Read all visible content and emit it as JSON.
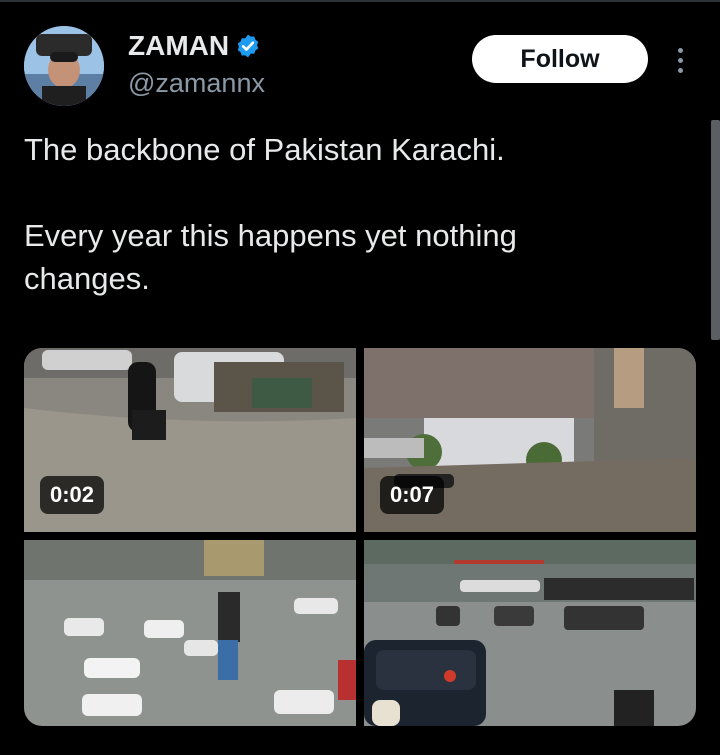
{
  "author": {
    "display_name": "ZAMAN",
    "handle": "@zamannx",
    "verified": true,
    "verified_color": "#1d9bf0"
  },
  "follow_label": "Follow",
  "tweet": {
    "paragraphs": [
      "The backbone of Pakistan Karachi.",
      "Every year this happens yet nothing changes."
    ]
  },
  "media": [
    {
      "kind": "video",
      "duration": "0:02",
      "icon": "video-thumbnail"
    },
    {
      "kind": "video",
      "duration": "0:07",
      "icon": "video-thumbnail"
    },
    {
      "kind": "image",
      "icon": "image-thumbnail"
    },
    {
      "kind": "image",
      "icon": "image-thumbnail"
    }
  ],
  "colors": {
    "background": "#000000",
    "text_primary": "#e7e9ea",
    "text_secondary": "#8b98a5",
    "button_bg": "#ffffff",
    "button_text": "#0f1419"
  }
}
